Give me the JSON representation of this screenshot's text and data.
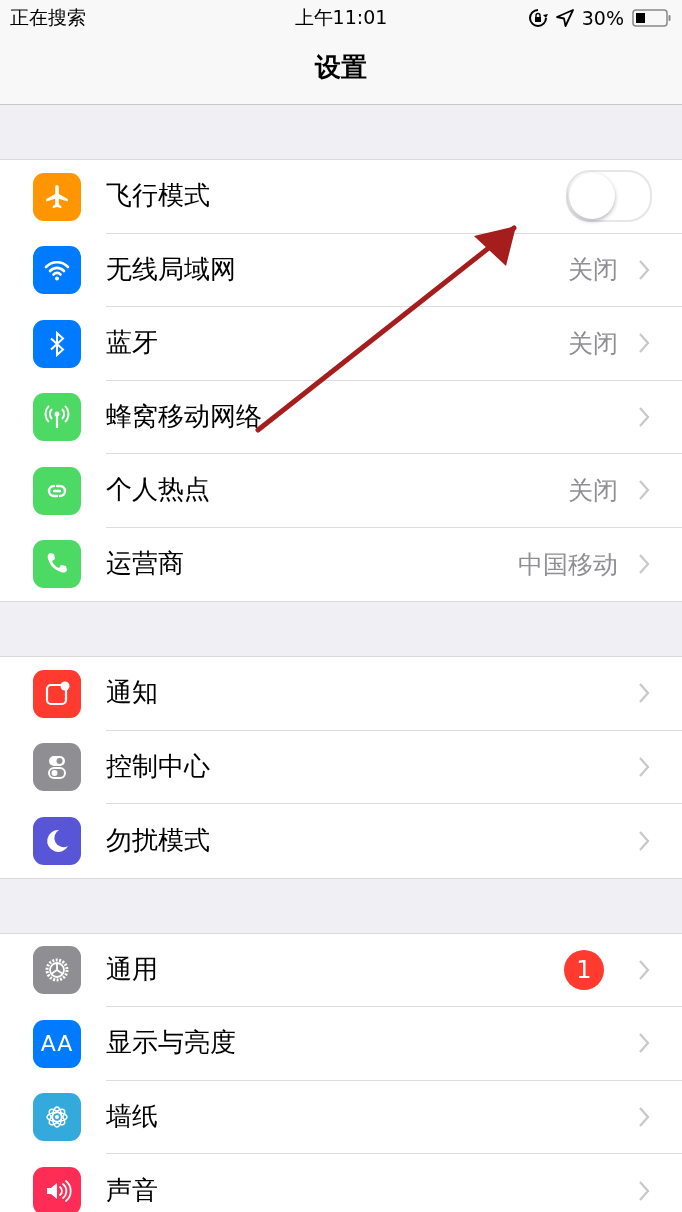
{
  "status_bar": {
    "carrier": "正在搜索",
    "time": "上午11:01",
    "battery": "30%"
  },
  "title": "设置",
  "groups": [
    {
      "items": [
        {
          "kind": "toggle",
          "label": "飞行模式",
          "color": "#ff9500",
          "on": false
        },
        {
          "kind": "link",
          "label": "无线局域网",
          "color": "#007aff",
          "value": "关闭"
        },
        {
          "kind": "link",
          "label": "蓝牙",
          "color": "#007aff",
          "value": "关闭"
        },
        {
          "kind": "link",
          "label": "蜂窝移动网络",
          "color": "#4cd964"
        },
        {
          "kind": "link",
          "label": "个人热点",
          "color": "#4cd964",
          "value": "关闭"
        },
        {
          "kind": "link",
          "label": "运营商",
          "color": "#4cd964",
          "value": "中国移动"
        }
      ]
    },
    {
      "items": [
        {
          "kind": "link",
          "label": "通知",
          "color": "#ff3b30"
        },
        {
          "kind": "link",
          "label": "控制中心",
          "color": "#8e8e93"
        },
        {
          "kind": "link",
          "label": "勿扰模式",
          "color": "#5856d6"
        }
      ]
    },
    {
      "items": [
        {
          "kind": "link",
          "label": "通用",
          "color": "#8e8e93",
          "badge": "1"
        },
        {
          "kind": "link",
          "label": "显示与亮度",
          "color": "#007aff",
          "icon_text": "AA"
        },
        {
          "kind": "link",
          "label": "墙纸",
          "color": "#34aadc"
        },
        {
          "kind": "link",
          "label": "声音",
          "color": "#ff2d55"
        }
      ]
    }
  ]
}
